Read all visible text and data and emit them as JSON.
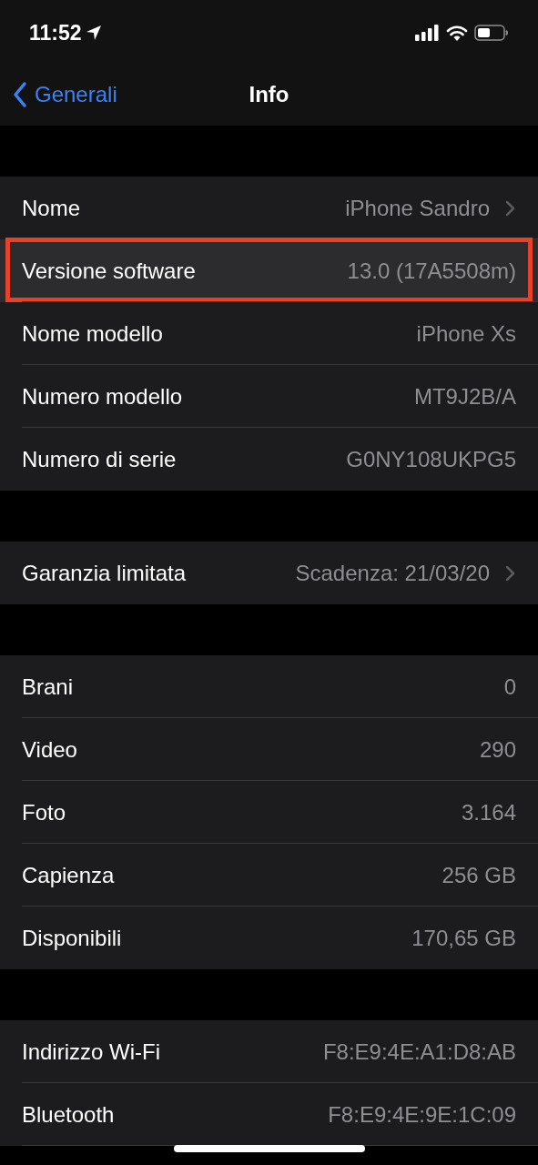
{
  "status_bar": {
    "time": "11:52"
  },
  "nav_bar": {
    "back_label": "Generali",
    "title": "Info"
  },
  "groups": [
    {
      "rows": [
        {
          "label": "Nome",
          "value": "iPhone Sandro",
          "disclosure": true,
          "highlighted": false
        },
        {
          "label": "Versione software",
          "value": "13.0 (17A5508m)",
          "disclosure": false,
          "highlighted": true
        },
        {
          "label": "Nome modello",
          "value": "iPhone Xs",
          "disclosure": false,
          "highlighted": false
        },
        {
          "label": "Numero modello",
          "value": "MT9J2B/A",
          "disclosure": false,
          "highlighted": false
        },
        {
          "label": "Numero di serie",
          "value": "G0NY108UKPG5",
          "disclosure": false,
          "highlighted": false
        }
      ]
    },
    {
      "rows": [
        {
          "label": "Garanzia limitata",
          "value": "Scadenza: 21/03/20",
          "disclosure": true,
          "highlighted": false
        }
      ]
    },
    {
      "rows": [
        {
          "label": "Brani",
          "value": "0",
          "disclosure": false,
          "highlighted": false
        },
        {
          "label": "Video",
          "value": "290",
          "disclosure": false,
          "highlighted": false
        },
        {
          "label": "Foto",
          "value": "3.164",
          "disclosure": false,
          "highlighted": false
        },
        {
          "label": "Capienza",
          "value": "256 GB",
          "disclosure": false,
          "highlighted": false
        },
        {
          "label": "Disponibili",
          "value": "170,65 GB",
          "disclosure": false,
          "highlighted": false
        }
      ]
    },
    {
      "rows": [
        {
          "label": "Indirizzo Wi-Fi",
          "value": "F8:E9:4E:A1:D8:AB",
          "disclosure": false,
          "highlighted": false
        },
        {
          "label": "Bluetooth",
          "value": "F8:E9:4E:9E:1C:09",
          "disclosure": false,
          "highlighted": false
        }
      ]
    }
  ]
}
